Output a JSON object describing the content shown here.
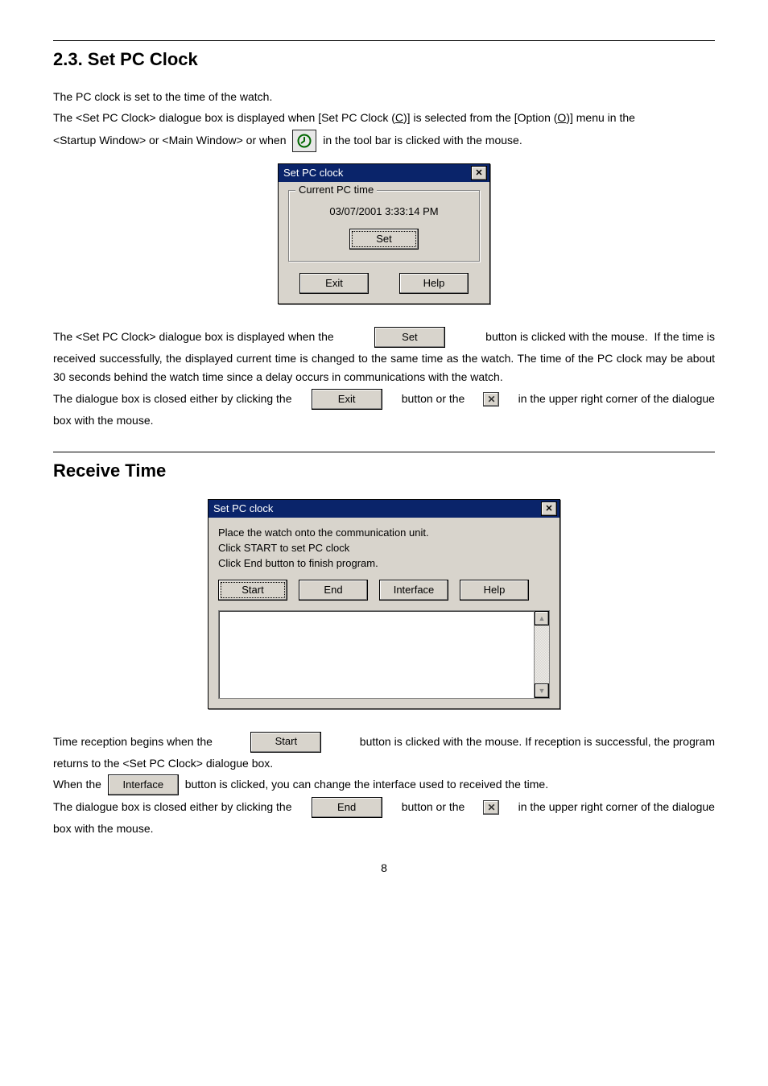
{
  "heading1": "2.3. Set PC Clock",
  "p1": "The PC clock is set to the time of the watch.",
  "p2a": "  The <Set PC Clock> dialogue box is displayed when [Set PC Clock (",
  "p2u": "C",
  "p2b": ")] is selected from the [Option (",
  "p2u2": "O",
  "p2c": ")] menu in the",
  "p3a": "<Startup Window> or <Main Window> or when ",
  "p3b": " in the tool bar is clicked with the mouse.",
  "dlg1": {
    "title": "Set PC clock",
    "group": "Current PC time",
    "time": "03/07/2001 3:33:14 PM",
    "set": "Set",
    "exit": "Exit",
    "help": "Help"
  },
  "p4a": "The <Set PC Clock> dialogue box is displayed when the ",
  "inlineSet": "Set",
  "p4b": " button is clicked with the mouse.  If the time is",
  "p5": "received successfully, the displayed current time is changed to the same time as the watch.  The time of the PC clock may be about 30 seconds behind the watch time since a delay occurs in communications with the watch.",
  "p6a": "The dialogue box is closed either by clicking the ",
  "inlineExit": "Exit",
  "p6b": " button or the ",
  "p6c": " in the upper right corner of the dialogue",
  "p6d": "box with the mouse.",
  "heading2": "Receive Time",
  "dlg2": {
    "title": "Set PC clock",
    "line1": "Place the watch onto the communication unit.",
    "line2": "Click START to set PC clock",
    "line3": "Click End button to finish program.",
    "start": "Start",
    "end": "End",
    "interface": "Interface",
    "help": "Help"
  },
  "p7a": "Time reception begins when the ",
  "inlineStart": "Start",
  "p7b": " button is clicked with the mouse. If reception is successful, the program",
  "p7c": "returns to the <Set PC Clock> dialogue box.",
  "p8a": "When the ",
  "inlineInterface": "Interface",
  "p8b": " button is clicked, you can change the interface used to received the time.",
  "p9a": "The dialogue box is closed either by clicking the ",
  "inlineEnd": "End",
  "p9b": " button or the ",
  "p9c": " in the upper right corner of the dialogue",
  "p9d": "box with the mouse.",
  "pageNum": "8"
}
